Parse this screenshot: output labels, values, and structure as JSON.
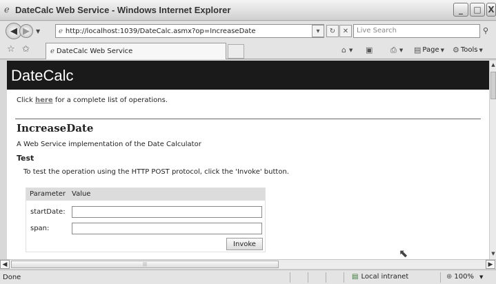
{
  "window": {
    "title": "DateCalc Web Service - Windows Internet Explorer",
    "controls": {
      "minimize": "_",
      "maximize": "□",
      "close": "X"
    }
  },
  "navigation": {
    "back_icon": "back-arrow-icon",
    "forward_icon": "forward-arrow-icon",
    "address": "http://localhost:1039/DateCalc.asmx?op=IncreaseDate",
    "search_placeholder": "Live Search"
  },
  "tabs": [
    {
      "label": "DateCalc Web Service",
      "active": true
    }
  ],
  "command_bar": {
    "page_label": "Page",
    "tools_label": "Tools"
  },
  "page": {
    "brand": "DateCalc",
    "intro": {
      "prefix": "Click ",
      "link": "here",
      "suffix": " for a complete list of operations."
    },
    "operation_name": "IncreaseDate",
    "operation_description": "A Web Service implementation of the Date Calculator",
    "test_heading": "Test",
    "test_instructions": "To test the operation using the HTTP POST protocol, click the 'Invoke' button.",
    "param_table": {
      "headers": [
        "Parameter",
        "Value"
      ],
      "rows": [
        {
          "name": "startDate:",
          "value": ""
        },
        {
          "name": "span:",
          "value": ""
        }
      ],
      "invoke_label": "Invoke"
    }
  },
  "status_bar": {
    "status": "Done",
    "zone": "Local intranet",
    "zoom": "100%"
  },
  "colors": {
    "banner_bg": "#1a1a1a",
    "link": "#6b6b6b",
    "chrome": "#e4e4e4"
  }
}
